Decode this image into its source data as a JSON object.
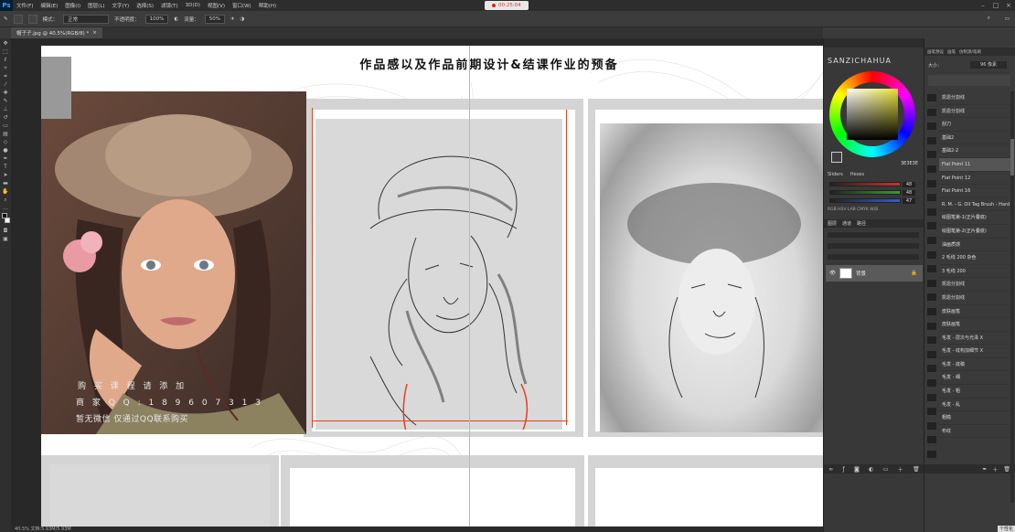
{
  "app": {
    "logo": "Ps"
  },
  "menu": [
    "文件(F)",
    "编辑(E)",
    "图像(I)",
    "图层(L)",
    "文字(Y)",
    "选择(S)",
    "滤镜(T)",
    "3D(D)",
    "视图(V)",
    "窗口(W)",
    "帮助(H)"
  ],
  "recording": {
    "time": "00:25:04"
  },
  "options": {
    "mode_label": "模式：",
    "mode_value": "正常",
    "opacity_label": "不透明度：",
    "opacity_value": "100%",
    "flow_label": "流量：",
    "flow_value": "50%"
  },
  "doc_tab": {
    "title": "帽子子.jpg @ 40.5%(RGB/8) *",
    "close": "×"
  },
  "canvas": {
    "title": "作品感以及作品前期设计&结课作业的预备",
    "watermark_lines": [
      "购 买 课 程 请 添 加",
      "商 家 Q Q : 1 8 9 6 0 7 3 1 3",
      "暂无微信 仅通过QQ联系购买"
    ]
  },
  "color_panel": {
    "brand": "SANZICHAHUA",
    "tabs": [
      "Sliders",
      "Hexes"
    ],
    "hex": "3E3E3E",
    "sliders": [
      {
        "value": "48",
        "color": "#c83232"
      },
      {
        "value": "48",
        "color": "#3a9a3a"
      },
      {
        "value": "47",
        "color": "#3a5ac8"
      }
    ],
    "modes": "RGB HSV LAB CMYK W/B"
  },
  "layers_panel": {
    "tabs": [
      "图层",
      "通道",
      "路径"
    ],
    "layer_name": "背景"
  },
  "brush_panel": {
    "tabs": [
      "画笔预设",
      "画笔",
      "仿制源/笔刷"
    ],
    "size_label": "大小：",
    "size_value": "96 像素",
    "items": [
      "凯恩分割线",
      "凯恩分割线",
      "刮刀",
      "基础2",
      "基础2-2",
      "Flat Point 11",
      "Flat Point 12",
      "Flat Point 16",
      "R. M. - G. Oil Tag Brush - Hard",
      "绘图笔第-1(正片叠底)",
      "绘图笔第-2(正片叠底)",
      "油画质感",
      "2 毛线 200 杂色",
      "3 毛线 200",
      "凯恩分割线",
      "凯恩分割线",
      "皮肤画笔",
      "皮肤画笔",
      "毛发 - 层次与光泽 X",
      "毛发 - 纹构加细节 X",
      "毛发 - 底稿",
      "毛发 - 细",
      "毛发 - 粗",
      "毛发 - 乱",
      "粗糙",
      "布纹"
    ],
    "selected_index": 5
  },
  "statusbar": {
    "text": "40.5% 文档:5.93M/5.93M"
  },
  "corner_hint": "个性化"
}
